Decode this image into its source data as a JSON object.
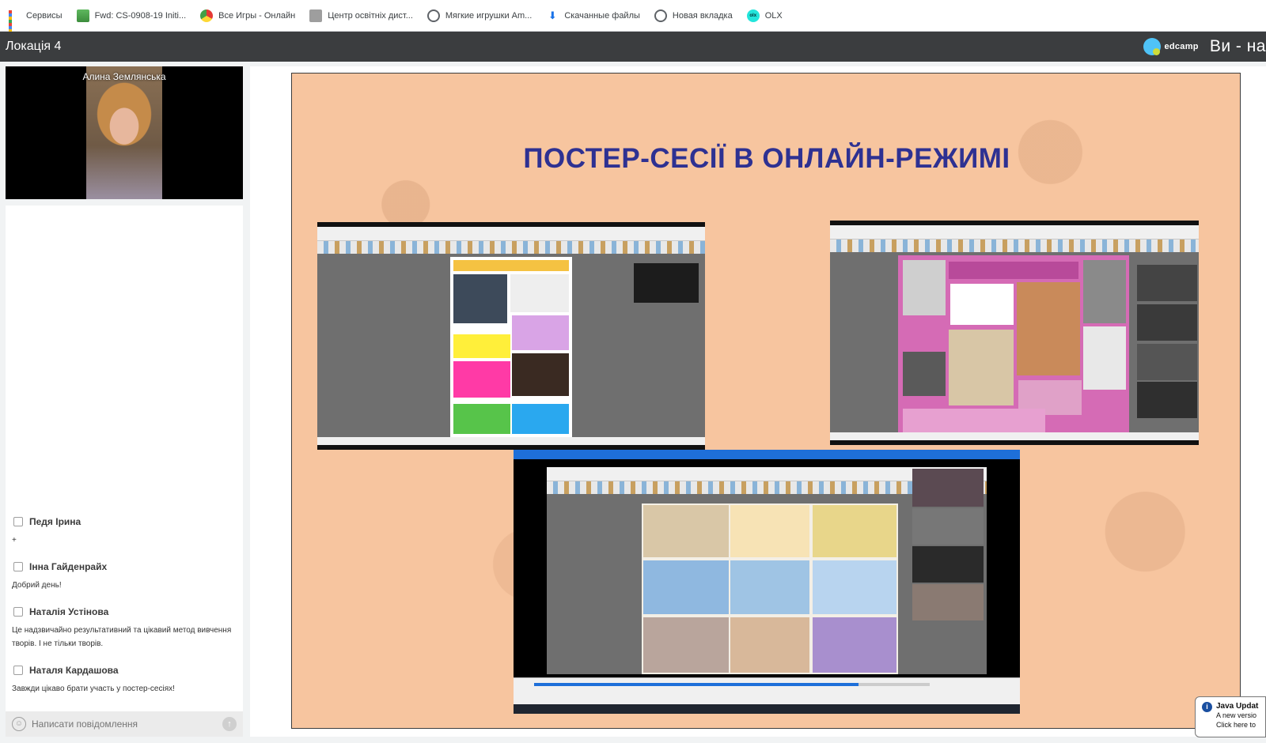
{
  "bookmarks": [
    {
      "label": "Сервисы",
      "icon": "apps-icon"
    },
    {
      "label": "Fwd: CS-0908-19 Initi...",
      "icon": "mail-icon"
    },
    {
      "label": "Все Игры - Онлайн",
      "icon": "games-icon"
    },
    {
      "label": "Центр освітніх дист...",
      "icon": "document-icon"
    },
    {
      "label": "Мягкие игрушки Am...",
      "icon": "globe-icon"
    },
    {
      "label": "Скачанные файлы",
      "icon": "download-icon"
    },
    {
      "label": "Новая вкладка",
      "icon": "globe-icon"
    },
    {
      "label": "OLX",
      "icon": "olx-icon"
    }
  ],
  "appbar": {
    "title": "Локація 4",
    "brand": "edcamp",
    "live_text": "Ви - на"
  },
  "camera": {
    "participant_name": "Алина Землянська"
  },
  "chat": {
    "messages": [
      {
        "author": "Педя Ірина",
        "text": "+"
      },
      {
        "author": "Інна Гайденрайх",
        "text": "Добрий день!"
      },
      {
        "author": "Наталія Устінова",
        "text": "Це надзвичайно результативний та цікавий метод вивчення творів. І не тільки творів."
      },
      {
        "author": "Наталя Кардашова",
        "text": "Завжди цікаво брати участь у постер-сесіях!"
      }
    ],
    "input_placeholder": "Написати повідомлення"
  },
  "slide": {
    "title": "ПОСТЕР-СЕСІЇ В ОНЛАЙН-РЕЖИМІ"
  },
  "java_popup": {
    "title": "Java Updat",
    "line1": "A new versio",
    "line2": "Click here to"
  },
  "colors": {
    "appbar_bg": "#3b3d3f",
    "slide_bg": "#f7c59f",
    "slide_title": "#2e3192",
    "chat_bg": "#ffffff"
  }
}
